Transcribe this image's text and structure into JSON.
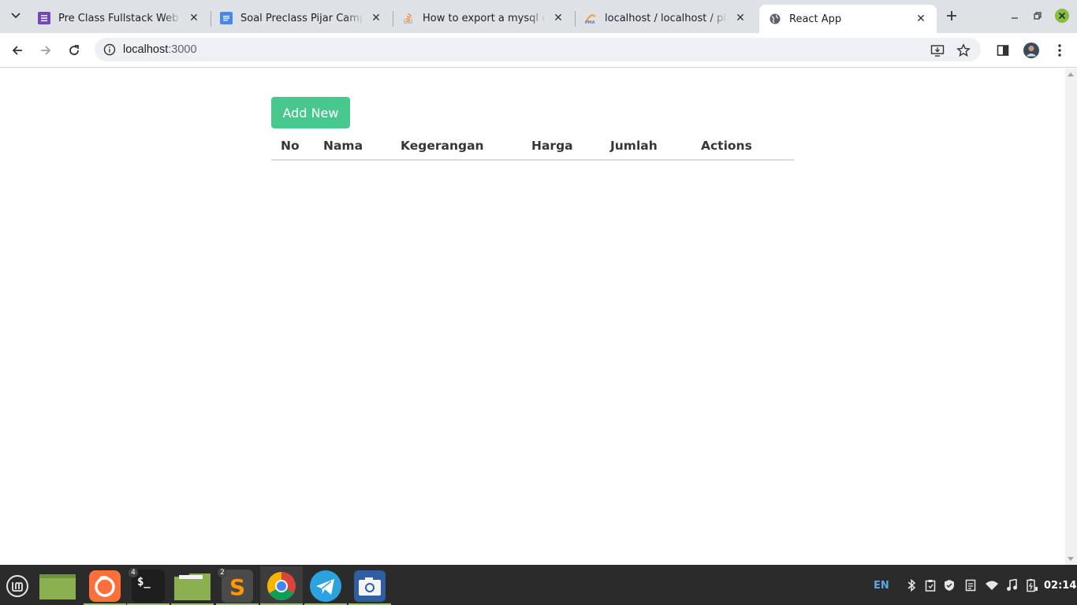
{
  "browser": {
    "tabs": [
      {
        "title": "Pre Class Fullstack Web dan",
        "favicon": "forms-icon",
        "active": false
      },
      {
        "title": "Soal Preclass Pijar Camp - G",
        "favicon": "docs-icon",
        "active": false
      },
      {
        "title": "How to export a mysql datab",
        "favicon": "stackoverflow-icon",
        "active": false
      },
      {
        "title": "localhost / localhost / pijarc",
        "favicon": "phpmyadmin-icon",
        "active": false
      },
      {
        "title": "React App",
        "favicon": "globe-icon",
        "active": true
      }
    ],
    "url_host": "localhost",
    "url_port": ":3000"
  },
  "page": {
    "add_button_label": "Add New",
    "add_button_color": "#48c78e",
    "table": {
      "columns": [
        "No",
        "Nama",
        "Kegerangan",
        "Harga",
        "Jumlah",
        "Actions"
      ],
      "rows": []
    }
  },
  "taskbar": {
    "apps": [
      {
        "name": "mint-menu",
        "badge": ""
      },
      {
        "name": "show-desktop",
        "badge": ""
      },
      {
        "name": "firefox",
        "badge": ""
      },
      {
        "name": "terminal",
        "badge": "4"
      },
      {
        "name": "files",
        "badge": ""
      },
      {
        "name": "sublime-text",
        "badge": "2"
      },
      {
        "name": "chrome",
        "badge": ""
      },
      {
        "name": "telegram",
        "badge": ""
      },
      {
        "name": "screenshot",
        "badge": ""
      }
    ],
    "language": "EN",
    "clock": "02:14"
  }
}
